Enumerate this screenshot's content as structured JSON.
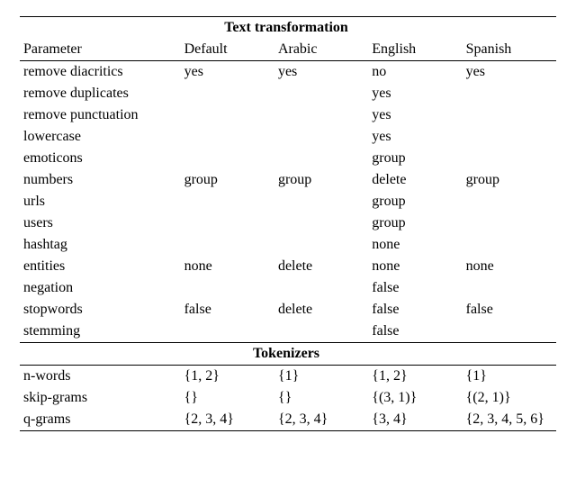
{
  "sections": {
    "text_transformation": "Text transformation",
    "tokenizers": "Tokenizers"
  },
  "columns": [
    "Parameter",
    "Default",
    "Arabic",
    "English",
    "Spanish"
  ],
  "text_transformation_rows": [
    {
      "param": "remove diacritics",
      "default": "yes",
      "arabic": "yes",
      "english": "no",
      "spanish": "yes"
    },
    {
      "param": "remove duplicates",
      "default": "",
      "arabic": "",
      "english": "yes",
      "spanish": ""
    },
    {
      "param": "remove punctuation",
      "default": "",
      "arabic": "",
      "english": "yes",
      "spanish": ""
    },
    {
      "param": "lowercase",
      "default": "",
      "arabic": "",
      "english": "yes",
      "spanish": ""
    },
    {
      "param": "emoticons",
      "default": "",
      "arabic": "",
      "english": "group",
      "spanish": ""
    },
    {
      "param": "numbers",
      "default": "group",
      "arabic": "group",
      "english": "delete",
      "spanish": "group"
    },
    {
      "param": "urls",
      "default": "",
      "arabic": "",
      "english": "group",
      "spanish": ""
    },
    {
      "param": "users",
      "default": "",
      "arabic": "",
      "english": "group",
      "spanish": ""
    },
    {
      "param": "hashtag",
      "default": "",
      "arabic": "",
      "english": "none",
      "spanish": ""
    },
    {
      "param": "entities",
      "default": "none",
      "arabic": "delete",
      "english": "none",
      "spanish": "none"
    },
    {
      "param": "negation",
      "default": "",
      "arabic": "",
      "english": "false",
      "spanish": ""
    },
    {
      "param": "stopwords",
      "default": "false",
      "arabic": "delete",
      "english": "false",
      "spanish": "false"
    },
    {
      "param": "stemming",
      "default": "",
      "arabic": "",
      "english": "false",
      "spanish": ""
    }
  ],
  "tokenizers_rows": [
    {
      "param": "n-words",
      "default": "{1, 2}",
      "arabic": "{1}",
      "english": "{1, 2}",
      "spanish": "{1}"
    },
    {
      "param": "skip-grams",
      "default": "{}",
      "arabic": "{}",
      "english": "{(3, 1)}",
      "spanish": "{(2, 1)}"
    },
    {
      "param": "q-grams",
      "default": "{2, 3, 4}",
      "arabic": "{2, 3, 4}",
      "english": "{3, 4}",
      "spanish": "{2, 3, 4, 5, 6}"
    }
  ]
}
